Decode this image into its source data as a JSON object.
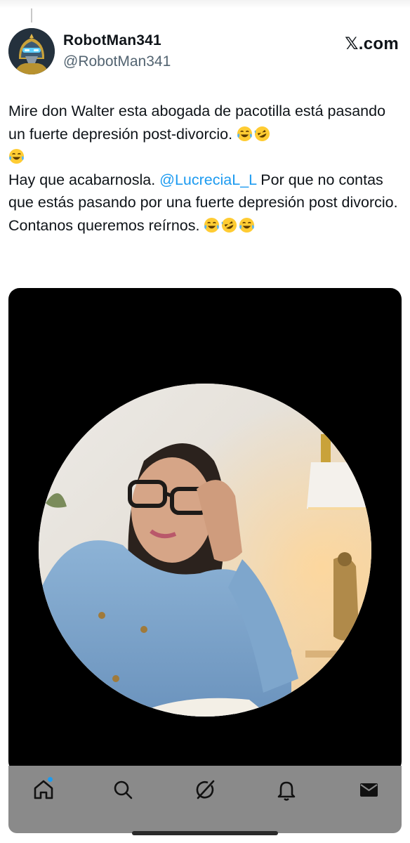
{
  "post": {
    "display_name": "RobotMan341",
    "handle": "@RobotMan341",
    "brand": "𝕏.com",
    "text_line_1": "Mire don Walter esta abogada de pacotilla está pasando un fuerte depresión post-divorcio. ",
    "text_line_2": "Hay que acabarnosla. ",
    "mention": "@LucreciaL_L",
    "text_line_3": " Por que no contas que estás pasando por una fuerte depresión post divorcio. Contanos queremos reírnos. "
  },
  "tabbar": {
    "items": [
      "home-icon",
      "search-icon",
      "grok-icon",
      "notifications-icon",
      "messages-icon"
    ],
    "active": "home-icon",
    "accent": "#1d9bf0"
  },
  "colors": {
    "mention": "#1d9bf0",
    "handle": "#536471",
    "text": "#0f1419",
    "media_background": "#000000",
    "tabbar": "#8a8a8a"
  }
}
